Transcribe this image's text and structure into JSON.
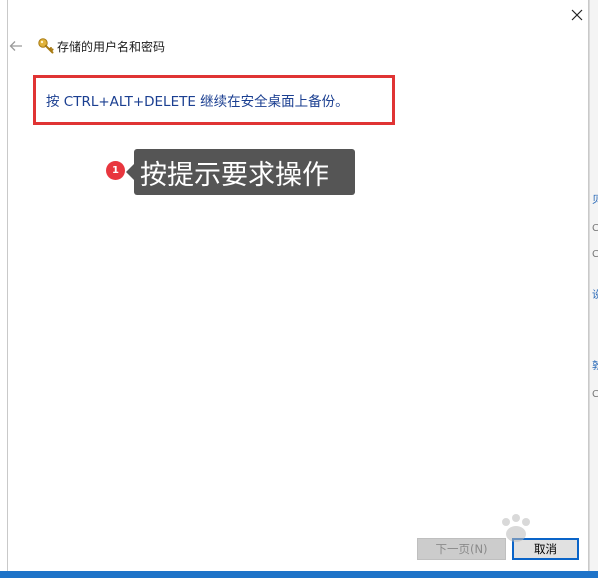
{
  "window": {
    "title": "存储的用户名和密码",
    "close_symbol": "✕"
  },
  "instruction": {
    "text": "按 CTRL+ALT+DELETE 继续在安全桌面上备份。"
  },
  "annotation": {
    "step_number": "1",
    "tooltip_text": "按提示要求操作"
  },
  "buttons": {
    "next_label": "下一页(N)",
    "cancel_label": "取消"
  },
  "background_strip": {
    "chars": [
      "贝",
      "C",
      "C",
      "设",
      "敦",
      "C"
    ]
  },
  "icons": {
    "back": "arrow-left-icon",
    "key": "key-icon",
    "close": "close-icon"
  },
  "colors": {
    "accent_blue": "#0a64c8",
    "instruction_text": "#1b3f91",
    "highlight_red": "#e03434",
    "badge_red": "#e8363e",
    "tooltip_bg": "#555555"
  }
}
